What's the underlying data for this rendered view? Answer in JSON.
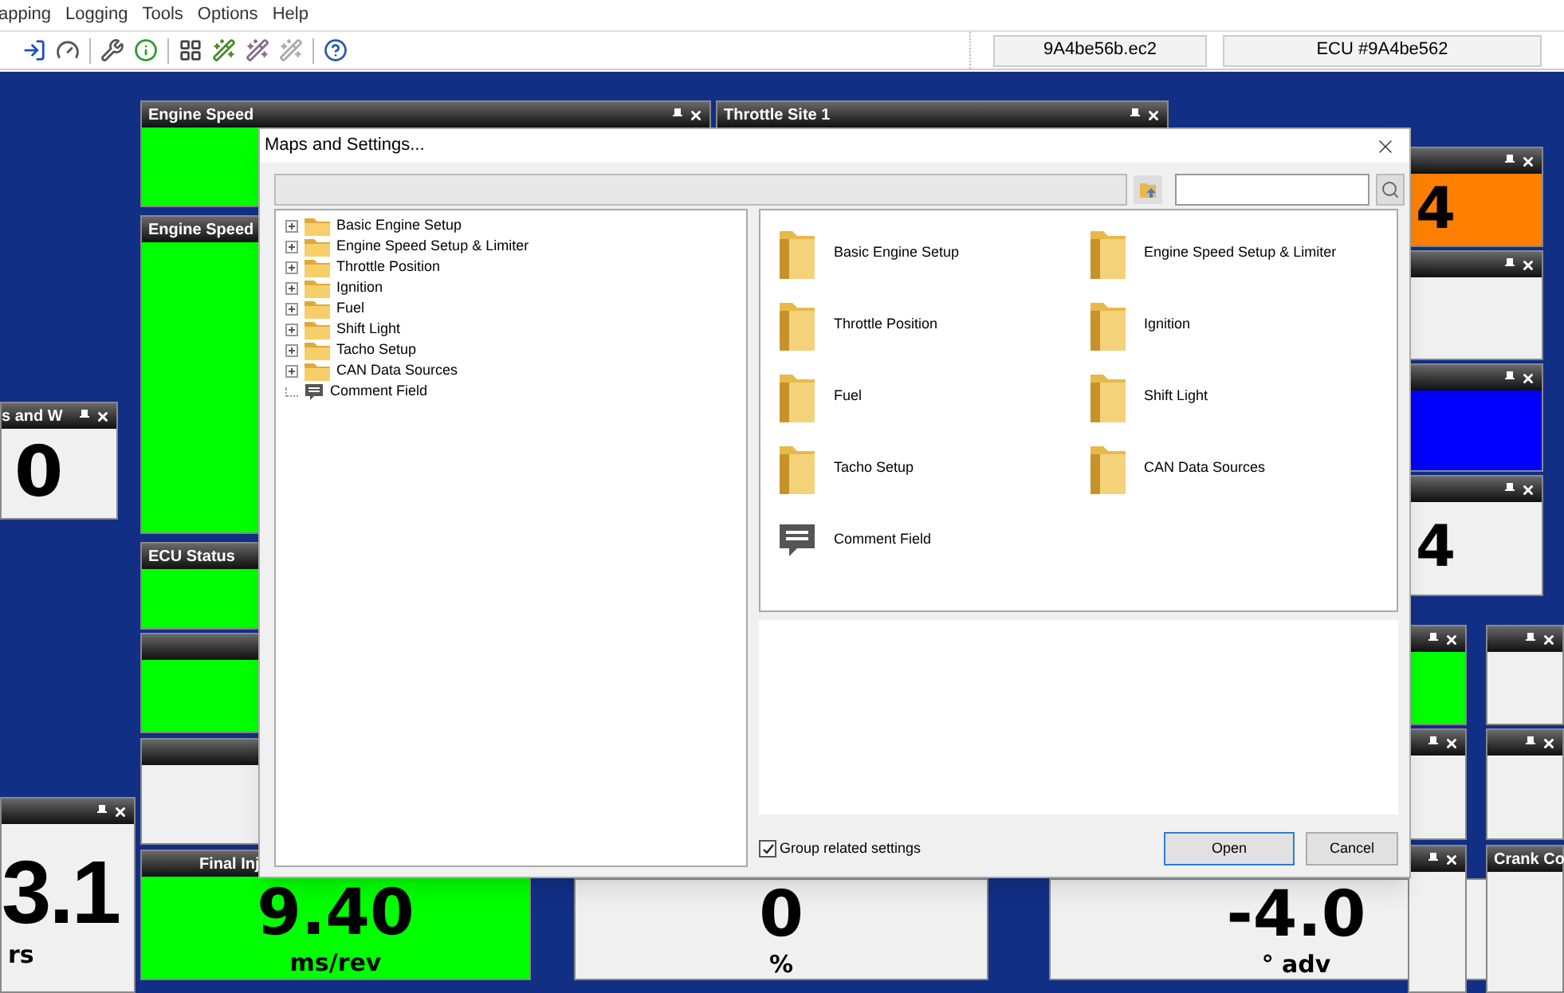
{
  "menu": [
    "apping",
    "Logging",
    "Tools",
    "Options",
    "Help"
  ],
  "status": [
    "9A4be56b.ec2",
    "ECU #9A4be562"
  ],
  "panels": [
    {
      "title": "Engine Speed",
      "color": "#00ff00"
    },
    {
      "title": "Throttle Site 1"
    },
    {
      "title": "Engine Speed",
      "color": "#00ff00"
    },
    {
      "title": "s and W",
      "color": "#f0f0f0",
      "value": "0"
    },
    {
      "title": "ECU Status",
      "color": "#00ff00"
    },
    {
      "color": "#00ff00"
    },
    {
      "color": "#f0f0f0"
    },
    {
      "color": "#f0f0f0",
      "value": "3.1",
      "unit": "rs"
    },
    {
      "title": "Final Inj",
      "color": "#00ff00",
      "value": "9.40",
      "unit": "ms/rev"
    },
    {
      "color": "#f0f0f0",
      "value": "0",
      "unit": "%"
    },
    {
      "color": "#f0f0f0",
      "value": "-4.0",
      "unit": "° adv"
    },
    {
      "color": "#ff8000",
      "value": "4"
    },
    {
      "color": "#f0f0f0"
    },
    {
      "color": "#0000ff"
    },
    {
      "color": "#f0f0f0",
      "value": "4"
    },
    {
      "color": "#00ff00"
    },
    {
      "color": "#f0f0f0"
    },
    {
      "color": "#f0f0f0"
    },
    {
      "color": "#f0f0f0"
    },
    {
      "color": "#f0f0f0"
    },
    {
      "title": "Crank Co",
      "color": "#f0f0f0"
    }
  ],
  "dialog": {
    "title": "Maps and Settings...",
    "tree": [
      {
        "label": "Basic Engine Setup",
        "kind": "folder"
      },
      {
        "label": "Engine Speed Setup & Limiter",
        "kind": "folder"
      },
      {
        "label": "Throttle Position",
        "kind": "folder"
      },
      {
        "label": "Ignition",
        "kind": "folder"
      },
      {
        "label": "Fuel",
        "kind": "folder"
      },
      {
        "label": "Shift Light",
        "kind": "folder"
      },
      {
        "label": "Tacho Setup",
        "kind": "folder"
      },
      {
        "label": "CAN Data Sources",
        "kind": "folder"
      },
      {
        "label": "Comment Field",
        "kind": "comment"
      }
    ],
    "icons": [
      {
        "label": "Basic Engine Setup",
        "kind": "folder"
      },
      {
        "label": "Engine Speed Setup & Limiter",
        "kind": "folder"
      },
      {
        "label": "Throttle Position",
        "kind": "folder"
      },
      {
        "label": "Ignition",
        "kind": "folder"
      },
      {
        "label": "Fuel",
        "kind": "folder"
      },
      {
        "label": "Shift Light",
        "kind": "folder"
      },
      {
        "label": "Tacho Setup",
        "kind": "folder"
      },
      {
        "label": "CAN Data Sources",
        "kind": "folder"
      },
      {
        "label": "Comment Field",
        "kind": "comment"
      }
    ],
    "group_related": {
      "label": "Group related settings",
      "checked": true
    },
    "buttons": [
      "Open",
      "Cancel"
    ]
  }
}
